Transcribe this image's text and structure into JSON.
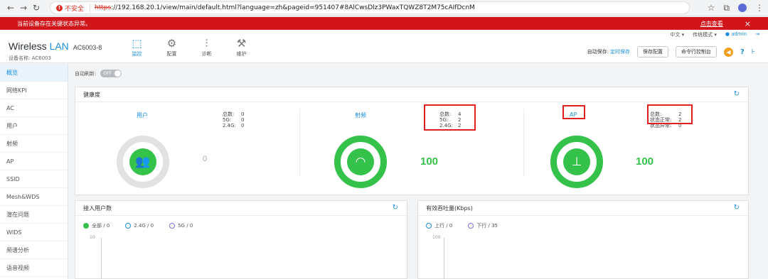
{
  "browser": {
    "insecure_label": "不安全",
    "url_scheme": "https",
    "url_rest": "://192.168.20.1/view/main/default.html?language=zh&pageid=951407#8AlCwsDlz3PWaxTQWZ8T2M75cAIfDcnM"
  },
  "alert": {
    "message": "当前设备存在关键状态异常。",
    "link": "点击查看",
    "close": "×"
  },
  "header": {
    "brand_main": "Wireless",
    "brand_lan": "LAN",
    "model": "AC6003-8",
    "device_name_label": "设备名称: AC6003",
    "nav": [
      {
        "label": "监控",
        "icon": "monitor-icon"
      },
      {
        "label": "配置",
        "icon": "gear-icon"
      },
      {
        "label": "诊断",
        "icon": "sliders-icon"
      },
      {
        "label": "维护",
        "icon": "maintenance-icon"
      }
    ],
    "language": "中文 ▾",
    "mode": "传统模式 ▾",
    "user": "admin",
    "auto_save_label": "自动保存:",
    "auto_save_value": "定时保存",
    "save_btn": "保存配置",
    "console_btn": "命令行控制台"
  },
  "sidebar": {
    "items": [
      {
        "label": "概览"
      },
      {
        "label": "网络KPI"
      },
      {
        "label": "AC"
      },
      {
        "label": "用户"
      },
      {
        "label": "射频"
      },
      {
        "label": "AP"
      },
      {
        "label": "SSID"
      },
      {
        "label": "Mesh&WDS"
      },
      {
        "label": "潜在问题"
      },
      {
        "label": "WIDS"
      },
      {
        "label": "频谱分析"
      },
      {
        "label": "语音视频"
      }
    ]
  },
  "main": {
    "auto_refresh_label": "自动刷新:",
    "auto_refresh_state": "OFF",
    "health": {
      "title": "健康度",
      "user": {
        "title": "用户",
        "score": "0",
        "stats": [
          {
            "k": "总数:",
            "v": "0"
          },
          {
            "k": "5G:",
            "v": "0"
          },
          {
            "k": "2.4G:",
            "v": "0"
          }
        ]
      },
      "radio": {
        "title": "射频",
        "score": "100",
        "stats": [
          {
            "k": "总数:",
            "v": "4"
          },
          {
            "k": "5G:",
            "v": "2"
          },
          {
            "k": "2.4G:",
            "v": "2"
          }
        ]
      },
      "ap": {
        "title": "AP",
        "score": "100",
        "stats": [
          {
            "k": "总数:",
            "v": "2"
          },
          {
            "k": "状态正常:",
            "v": "2"
          },
          {
            "k": "状态异常:",
            "v": "0"
          }
        ]
      }
    },
    "users_panel": {
      "title": "接入用户数",
      "legend": [
        "全部 / 0",
        "2.4G / 0",
        "5G / 0"
      ],
      "axis_max": "10"
    },
    "throughput_panel": {
      "title": "有效吞吐量(Kbps)",
      "legend": [
        "上行 / 0",
        "下行 / 35"
      ],
      "axis_max": "100"
    }
  }
}
